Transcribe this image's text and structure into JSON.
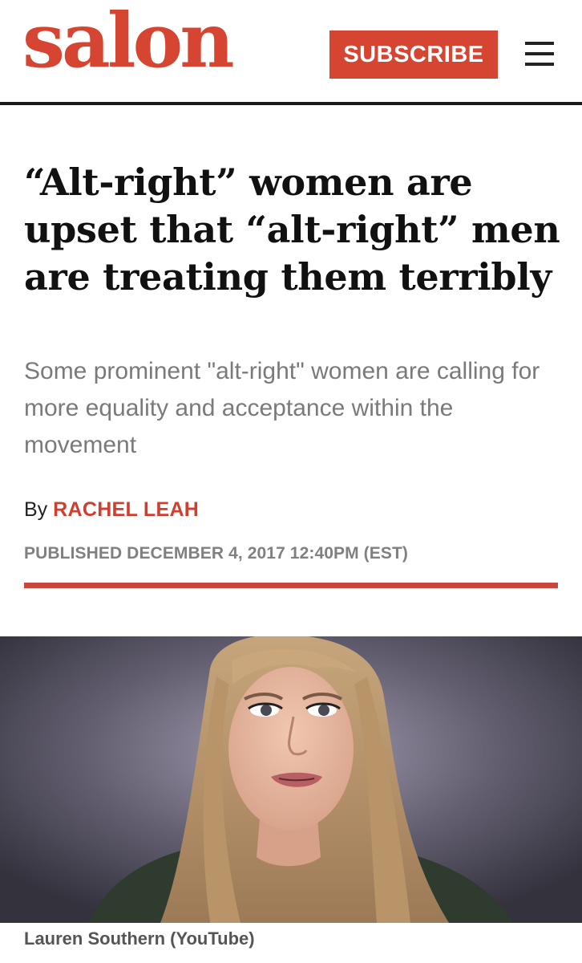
{
  "header": {
    "logo": "salon",
    "subscribe_label": "SUBSCRIBE",
    "menu_icon": "hamburger-menu-icon",
    "brand_color": "#d64531"
  },
  "article": {
    "headline": "“Alt-right” women are upset that “alt-right” men are treating them terribly",
    "dek": "Some prominent \"alt-right\" women are calling for more equality and acceptance within the movement",
    "byline_prefix": "By",
    "author": "RACHEL LEAH",
    "published": "PUBLISHED DECEMBER 4, 2017 12:40PM (EST)",
    "accent_color": "#c9463a"
  },
  "photo": {
    "caption": "Lauren Southern (YouTube)"
  }
}
